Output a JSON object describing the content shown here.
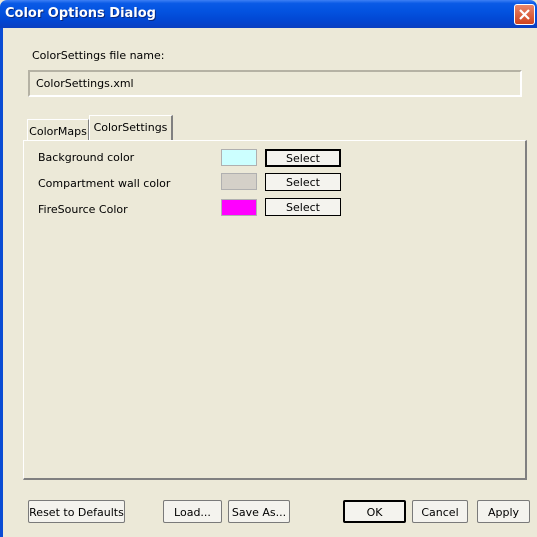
{
  "window": {
    "title": "Color Options Dialog"
  },
  "file": {
    "label": "ColorSettings file name:",
    "value": "ColorSettings.xml"
  },
  "tabs": [
    {
      "label": "ColorMaps"
    },
    {
      "label": "ColorSettings"
    }
  ],
  "settings": [
    {
      "label": "Background color",
      "color": "#ccffff",
      "button": "Select"
    },
    {
      "label": "Compartment wall color",
      "color": "#d4d0c8",
      "button": "Select"
    },
    {
      "label": "FireSource Color",
      "color": "#ff00ff",
      "button": "Select"
    }
  ],
  "buttons": {
    "reset": "Reset to Defaults",
    "load": "Load...",
    "save_as": "Save As...",
    "ok": "OK",
    "cancel": "Cancel",
    "apply": "Apply"
  },
  "colors": {
    "titlebar": "#0353e0",
    "dialog_bg": "#ece9d8",
    "close": "#d0431e"
  }
}
